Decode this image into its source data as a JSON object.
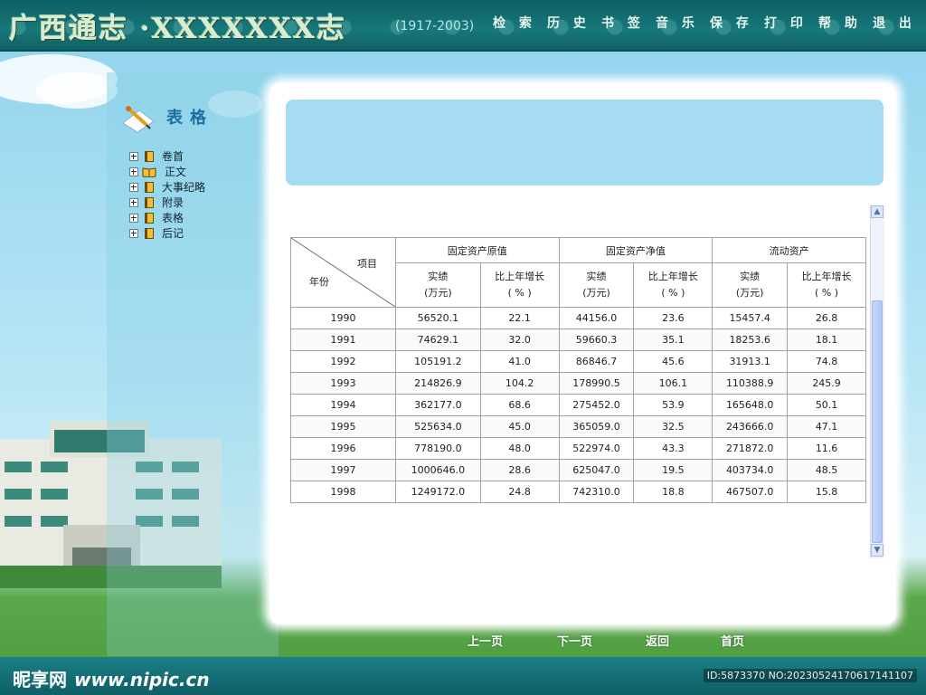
{
  "header": {
    "logo": "广西通志 ·XXXXXXX志",
    "years": "(1917-2003)",
    "nav": [
      "检 索",
      "历 史",
      "书 签",
      "音 乐",
      "保 存",
      "打 印",
      "帮 助",
      "退 出"
    ]
  },
  "sidebar": {
    "title": "表格",
    "items": [
      {
        "label": "卷首",
        "icon": "book-icon"
      },
      {
        "label": "正文",
        "icon": "open-book-icon"
      },
      {
        "label": "大事纪略",
        "icon": "book-icon"
      },
      {
        "label": "附录",
        "icon": "book-icon"
      },
      {
        "label": "表格",
        "icon": "book-icon"
      },
      {
        "label": "后记",
        "icon": "book-icon"
      }
    ]
  },
  "table": {
    "corner_item": "项目",
    "corner_year": "年份",
    "groups": [
      "固定资产原值",
      "固定资产净值",
      "流动资产"
    ],
    "sub": [
      {
        "a": "实绩",
        "b": "(万元)"
      },
      {
        "a": "比上年增长",
        "b": "( % )"
      },
      {
        "a": "实绩",
        "b": "(万元)"
      },
      {
        "a": "比上年增长",
        "b": "( % )"
      },
      {
        "a": "实绩",
        "b": "(万元)"
      },
      {
        "a": "比上年增长",
        "b": "( % )"
      }
    ],
    "rows": [
      [
        "1990",
        "56520.1",
        "22.1",
        "44156.0",
        "23.6",
        "15457.4",
        "26.8"
      ],
      [
        "1991",
        "74629.1",
        "32.0",
        "59660.3",
        "35.1",
        "18253.6",
        "18.1"
      ],
      [
        "1992",
        "105191.2",
        "41.0",
        "86846.7",
        "45.6",
        "31913.1",
        "74.8"
      ],
      [
        "1993",
        "214826.9",
        "104.2",
        "178990.5",
        "106.1",
        "110388.9",
        "245.9"
      ],
      [
        "1994",
        "362177.0",
        "68.6",
        "275452.0",
        "53.9",
        "165648.0",
        "50.1"
      ],
      [
        "1995",
        "525634.0",
        "45.0",
        "365059.0",
        "32.5",
        "243666.0",
        "47.1"
      ],
      [
        "1996",
        "778190.0",
        "48.0",
        "522974.0",
        "43.3",
        "271872.0",
        "11.6"
      ],
      [
        "1997",
        "1000646.0",
        "28.6",
        "625047.0",
        "19.5",
        "403734.0",
        "48.5"
      ],
      [
        "1998",
        "1249172.0",
        "24.8",
        "742310.0",
        "18.8",
        "467507.0",
        "15.8"
      ]
    ]
  },
  "pagenav": {
    "prev": "上一页",
    "next": "下一页",
    "back": "返回",
    "home": "首页"
  },
  "footer": {
    "brand_cn": "昵享网",
    "brand_url": "www.nipic.cn",
    "id_text": "ID:5873370 NO:20230524170617141107"
  },
  "colors": {
    "header": "#17787b",
    "banner": "#a6dcf3",
    "footer": "#1c7f86"
  }
}
